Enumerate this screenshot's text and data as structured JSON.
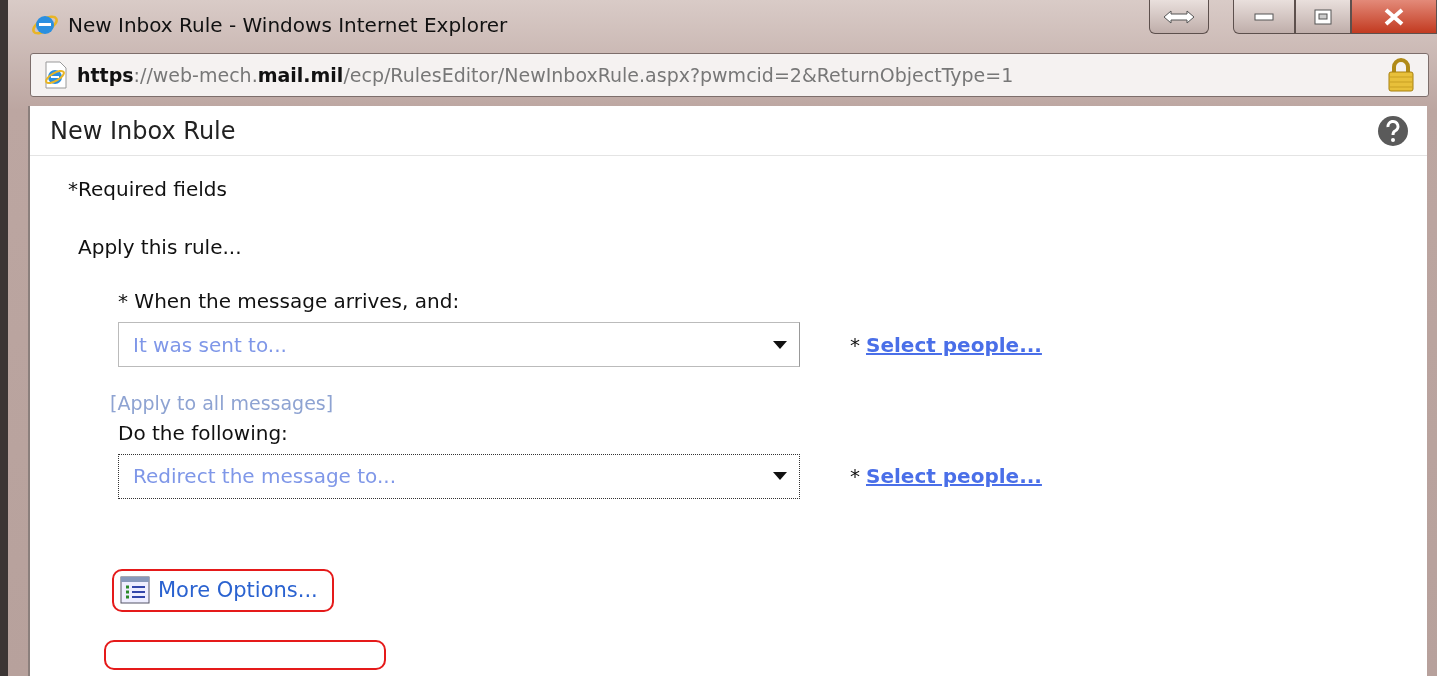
{
  "window": {
    "title": "New Inbox Rule - Windows Internet Explorer"
  },
  "address_bar": {
    "url_parts": [
      {
        "text": "https",
        "strong": true
      },
      {
        "text": "://web-mech.",
        "strong": false
      },
      {
        "text": "mail.mil",
        "strong": true
      },
      {
        "text": "/ecp/RulesEditor/NewInboxRule.aspx?pwmcid=2&ReturnObjectType=1",
        "strong": false
      }
    ]
  },
  "dialog": {
    "title": "New Inbox Rule",
    "required_note": "*Required fields",
    "intro": "Apply this rule...",
    "sections": [
      {
        "label": "* When the message arrives, and:",
        "dropdown": {
          "value": "It was sent to...",
          "focused": false
        },
        "link_prefix": "*",
        "link": "Select people...",
        "extra_link": "[Apply to all messages]"
      },
      {
        "label": "Do the following:",
        "dropdown": {
          "value": "Redirect the message to...",
          "focused": true
        },
        "link_prefix": "*",
        "link": "Select people..."
      }
    ],
    "buttons": [
      {
        "label": "More Options...",
        "highlighted": true
      },
      {
        "highlighted": true
      }
    ]
  }
}
